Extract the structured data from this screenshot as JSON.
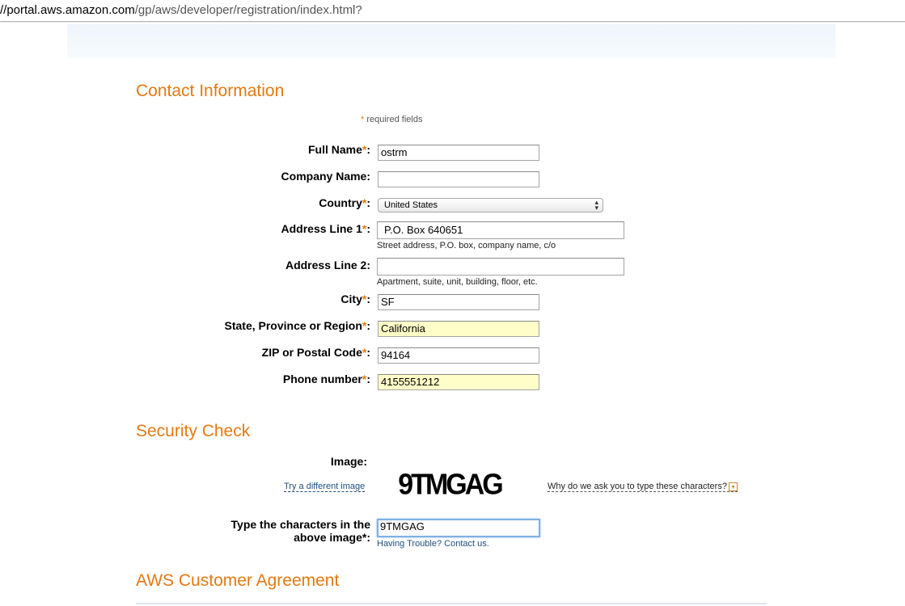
{
  "browser": {
    "url_host": "//portal.aws.amazon.com",
    "url_path": "/gp/aws/developer/registration/index.html?"
  },
  "contact": {
    "heading": "Contact Information",
    "required_star": "*",
    "required_note": "required fields",
    "fields": {
      "full_name": {
        "label": "Full Name",
        "value": "ostrm"
      },
      "company_name": {
        "label": "Company Name:",
        "value": ""
      },
      "country": {
        "label": "Country",
        "value": "United States"
      },
      "address1": {
        "label": "Address Line 1",
        "value": "P.O. Box 640651",
        "hint": "Street address, P.O. box, company name, c/o"
      },
      "address2": {
        "label": "Address Line 2:",
        "value": "",
        "hint": "Apartment, suite, unit, building, floor, etc."
      },
      "city": {
        "label": "City",
        "value": "SF"
      },
      "state": {
        "label": "State, Province or Region",
        "value": "California"
      },
      "zip": {
        "label": "ZIP or Postal Code",
        "value": "94164"
      },
      "phone": {
        "label": "Phone number",
        "value": "4155551212"
      }
    }
  },
  "security": {
    "heading": "Security Check",
    "image_label": "Image:",
    "try_different": "Try a different image",
    "captcha_text": "9TMGAG",
    "why_link": "Why do we ask you to type these characters?",
    "type_label_line1": "Type the characters in the",
    "type_label_line2": "above image*:",
    "typed_value": "9TMGAG",
    "help_link": "Having Trouble? Contact us."
  },
  "agreement": {
    "heading": "AWS Customer Agreement"
  },
  "colors": {
    "heading_orange": "#e47911",
    "autofill_yellow": "#fffdc8",
    "link_blue": "#1f4e79"
  }
}
